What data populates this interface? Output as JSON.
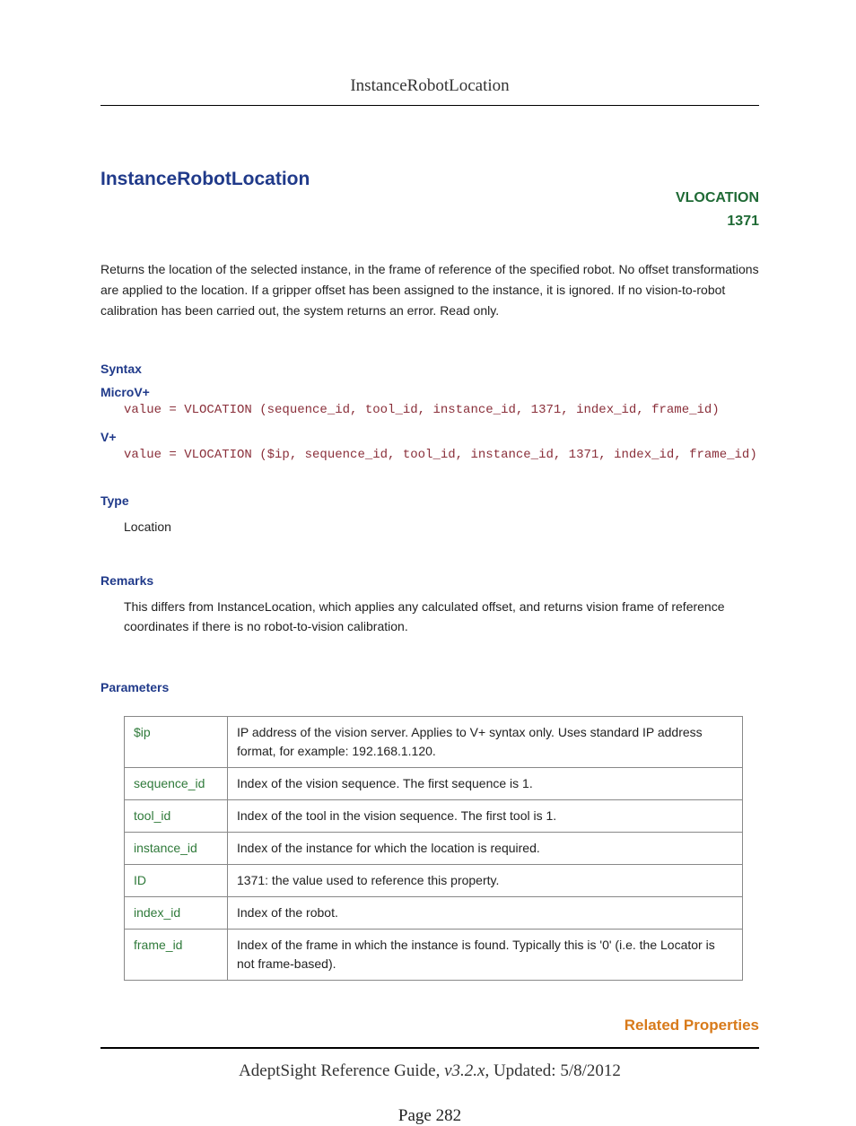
{
  "header": {
    "running_title": "InstanceRobotLocation"
  },
  "title": "InstanceRobotLocation",
  "badge": {
    "keyword": "VLOCATION",
    "code": "1371"
  },
  "intro": "Returns the location of the selected instance, in the frame of reference of the specified robot. No offset transformations are applied to the location. If a gripper offset has been assigned to the instance, it is ignored. If no vision-to-robot calibration has been carried out, the system returns an error. Read only.",
  "sections": {
    "syntax": {
      "heading": "Syntax",
      "microv": {
        "label": "MicroV+",
        "code": "value = VLOCATION (sequence_id, tool_id, instance_id, 1371, index_id, frame_id)"
      },
      "vplus": {
        "label": "V+",
        "code": "value = VLOCATION ($ip, sequence_id, tool_id, instance_id, 1371, index_id, frame_id)"
      }
    },
    "type": {
      "heading": "Type",
      "value": "Location"
    },
    "remarks": {
      "heading": "Remarks",
      "text": "This differs from InstanceLocation, which applies any calculated offset, and returns vision frame of reference coordinates if there is no robot-to-vision calibration."
    },
    "parameters": {
      "heading": "Parameters",
      "rows": [
        {
          "name": "$ip",
          "desc": "IP address of the vision server. Applies to V+ syntax only. Uses standard IP address format, for example: 192.168.1.120."
        },
        {
          "name": "sequence_id",
          "desc": "Index of the vision sequence. The first sequence is 1."
        },
        {
          "name": "tool_id",
          "desc": "Index of the tool in the vision sequence. The first tool is 1."
        },
        {
          "name": "instance_id",
          "desc": "Index of the instance for which the location is required."
        },
        {
          "name": "ID",
          "desc": "1371: the value used to reference this property."
        },
        {
          "name": "index_id",
          "desc": "Index of the robot."
        },
        {
          "name": "frame_id",
          "desc": "Index of the frame in which the instance is found. Typically this is '0' (i.e. the Locator is not frame-based)."
        }
      ]
    },
    "related": {
      "heading": "Related Properties"
    }
  },
  "footer": {
    "guide": "AdeptSight Reference Guide",
    "version_prefix": ", ",
    "version": "v3.2.x",
    "updated_prefix": ", Updated: ",
    "updated": "5/8/2012",
    "page_label": "Page 282"
  }
}
